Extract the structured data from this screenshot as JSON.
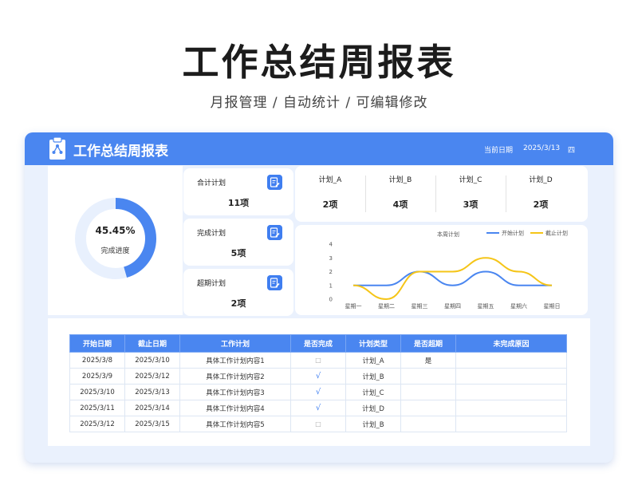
{
  "hero": {
    "title": "工作总结周报表",
    "subtitle": "月报管理 / 自动统计 /  可编辑修改"
  },
  "header": {
    "title": "工作总结周报表",
    "date_label": "当前日期",
    "date": "2025/3/13",
    "weekday": "四"
  },
  "progress": {
    "value_text": "45.45%",
    "label": "完成进度",
    "fraction": 0.4545
  },
  "stats": [
    {
      "title": "合计计划",
      "value": "11项"
    },
    {
      "title": "完成计划",
      "value": "5项"
    },
    {
      "title": "超期计划",
      "value": "2项"
    }
  ],
  "plans": [
    {
      "name": "计划_A",
      "value": "2项"
    },
    {
      "name": "计划_B",
      "value": "4项"
    },
    {
      "name": "计划_C",
      "value": "3项"
    },
    {
      "name": "计划_D",
      "value": "2项"
    }
  ],
  "colors": {
    "primary": "#4a86f0",
    "ring_track": "#e8f0fd",
    "start_line": "#4a86f0",
    "end_line": "#f5c518"
  },
  "chart_data": {
    "type": "line",
    "title": "本周计划",
    "categories": [
      "星期一",
      "星期二",
      "星期三",
      "星期四",
      "星期五",
      "星期六",
      "星期日"
    ],
    "series": [
      {
        "name": "开始计划",
        "values": [
          1,
          1,
          2,
          1,
          2,
          1,
          1
        ]
      },
      {
        "name": "截止计划",
        "values": [
          1,
          0,
          2,
          2,
          3,
          2,
          1
        ]
      }
    ],
    "ylim": [
      0,
      4
    ],
    "yticks": [
      "0",
      "1",
      "2",
      "3",
      "4"
    ],
    "legend": "top-right",
    "smooth": true
  },
  "table": {
    "headers": [
      "开始日期",
      "截止日期",
      "工作计划",
      "是否完成",
      "计划类型",
      "是否超期",
      "未完成原因"
    ],
    "rows": [
      [
        "2025/3/8",
        "2025/3/10",
        "具体工作计划内容1",
        "□",
        "计划_A",
        "是",
        ""
      ],
      [
        "2025/3/9",
        "2025/3/12",
        "具体工作计划内容2",
        "√",
        "计划_B",
        "",
        ""
      ],
      [
        "2025/3/10",
        "2025/3/13",
        "具体工作计划内容3",
        "√",
        "计划_C",
        "",
        ""
      ],
      [
        "2025/3/11",
        "2025/3/14",
        "具体工作计划内容4",
        "√",
        "计划_D",
        "",
        ""
      ],
      [
        "2025/3/12",
        "2025/3/15",
        "具体工作计划内容5",
        "□",
        "计划_B",
        "",
        ""
      ]
    ]
  }
}
